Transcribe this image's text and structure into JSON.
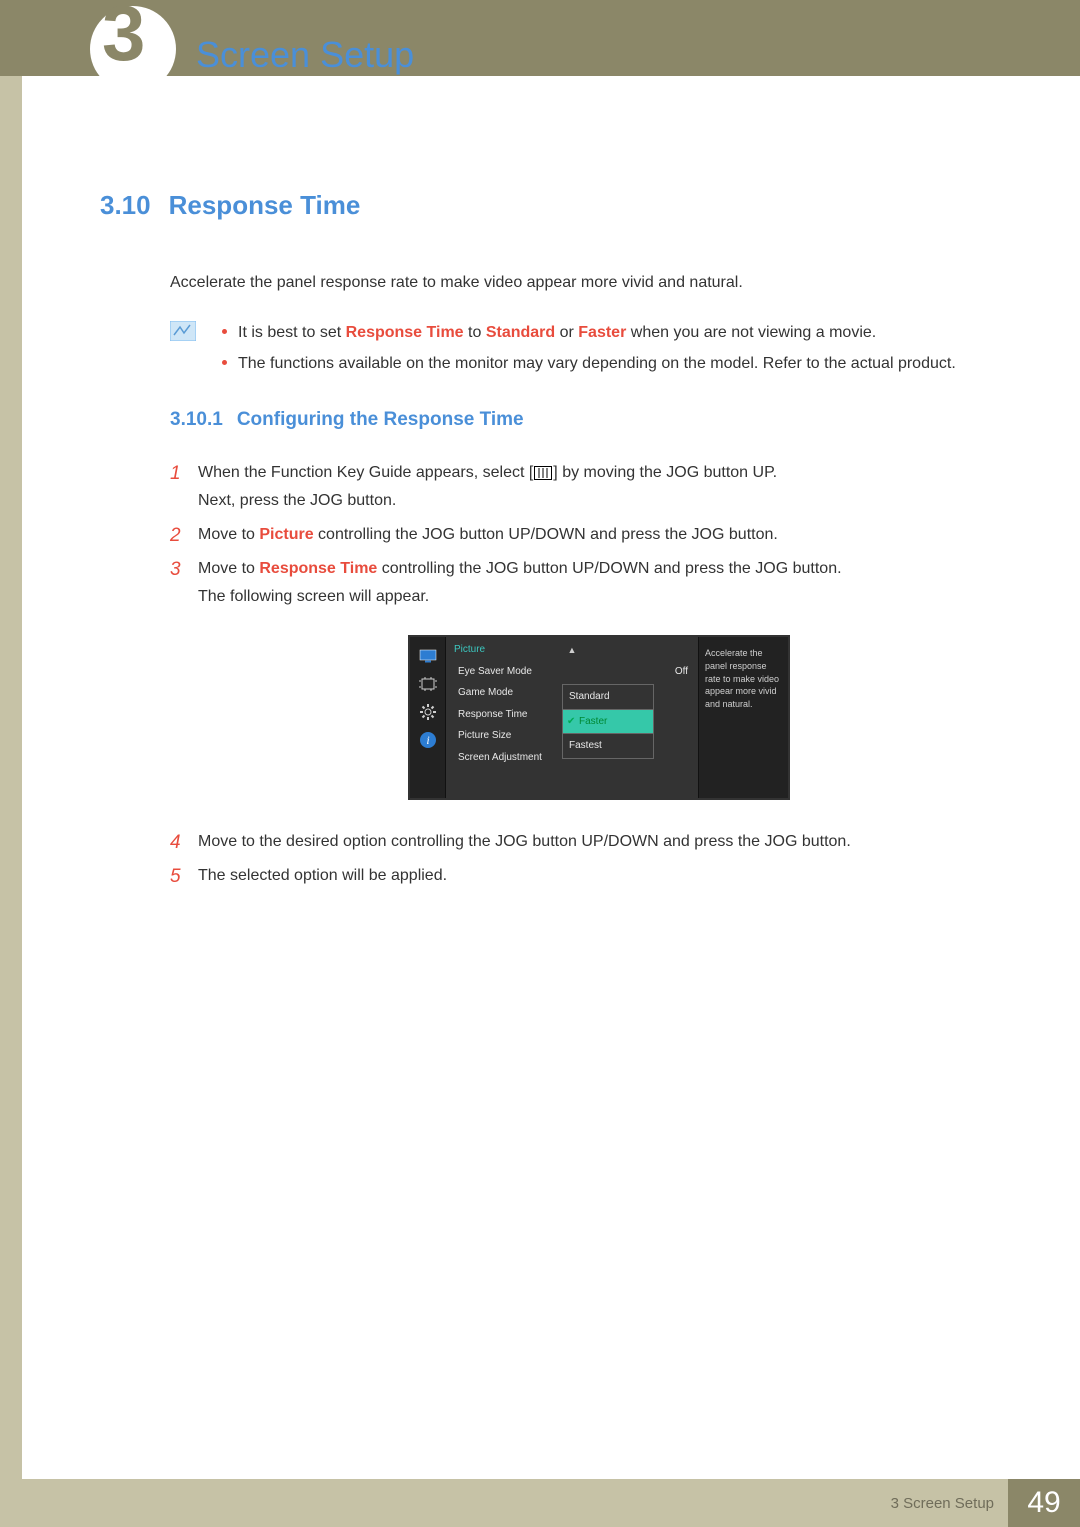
{
  "header": {
    "chapter_number": "3",
    "page_title": "Screen Setup"
  },
  "section": {
    "number": "3.10",
    "title": "Response Time",
    "intro": "Accelerate the panel response rate to make video appear more vivid and natural."
  },
  "notes": {
    "item1_pre": "It is best to set ",
    "item1_em1": "Response Time",
    "item1_mid1": " to ",
    "item1_em2": "Standard",
    "item1_mid2": " or ",
    "item1_em3": "Faster",
    "item1_post": " when you are not viewing a movie.",
    "item2": "The functions available on the monitor may vary depending on the model. Refer to the actual product."
  },
  "subsection": {
    "number": "3.10.1",
    "title": "Configuring the Response Time"
  },
  "steps": {
    "s1_pre": "When the Function Key Guide appears, select [",
    "s1_post": "] by moving the JOG button UP.",
    "s1_line2": "Next, press the JOG button.",
    "s2_pre": "Move to ",
    "s2_em": "Picture",
    "s2_post": " controlling the JOG button UP/DOWN and press the JOG button.",
    "s3_pre": "Move to ",
    "s3_em": "Response Time",
    "s3_post": " controlling the JOG button UP/DOWN and press the JOG button.",
    "s3_line2": "The following screen will appear.",
    "s4": "Move to the desired option controlling the JOG button UP/DOWN and press the JOG button.",
    "s5": "The selected option will be applied."
  },
  "osd": {
    "tab": "Picture",
    "rows": {
      "eye_saver": "Eye Saver Mode",
      "eye_saver_val": "Off",
      "game_mode": "Game Mode",
      "response_time": "Response Time",
      "picture_size": "Picture Size",
      "screen_adj": "Screen Adjustment"
    },
    "options": {
      "standard": "Standard",
      "faster": "Faster",
      "fastest": "Fastest"
    },
    "help_text": "Accelerate the panel response rate to make video appear more vivid and natural."
  },
  "footer": {
    "chapter_ref": "3 Screen Setup",
    "page_number": "49"
  }
}
